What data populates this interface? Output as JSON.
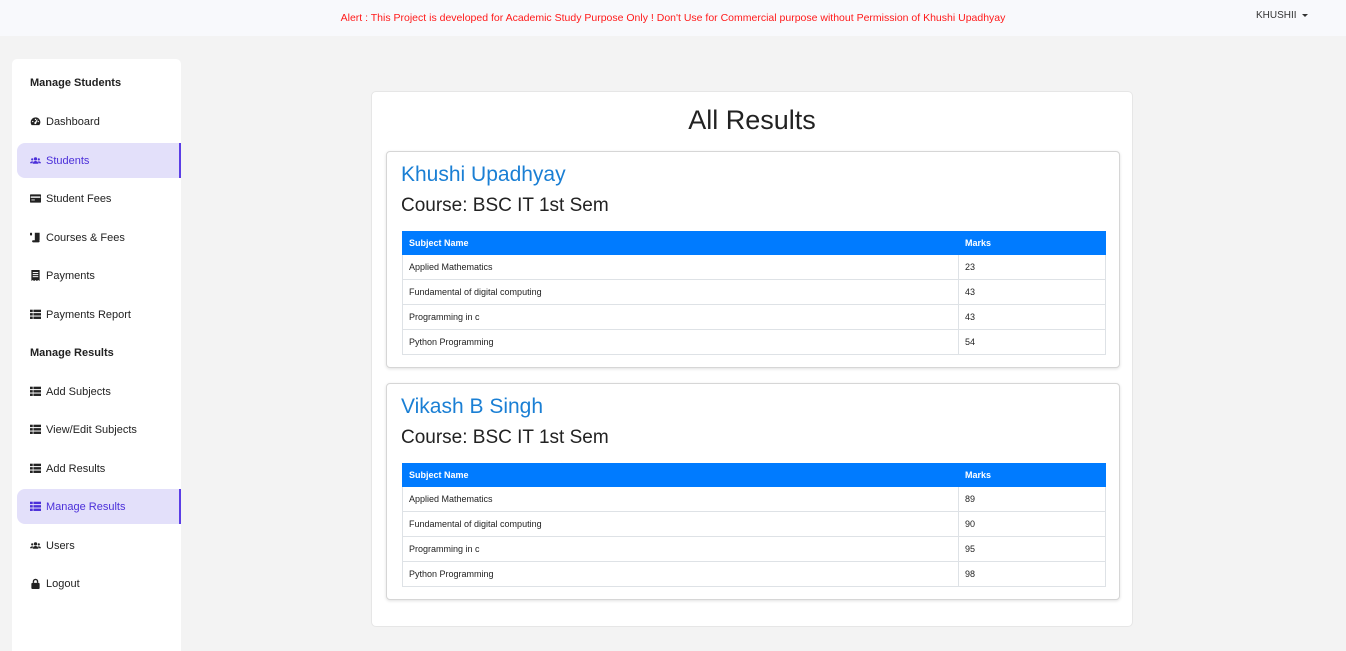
{
  "topbar": {
    "alert": "Alert : This Project is developed for Academic Study Purpose Only ! Don't Use for Commercial purpose without Permission of Khushi Upadhyay",
    "user": "KHUSHII",
    "alert_color": "#ff1a1a"
  },
  "sidebar": {
    "heading_students": "Manage Students",
    "heading_results": "Manage Results",
    "items": [
      {
        "label": "Dashboard",
        "icon": "dashboard-icon"
      },
      {
        "label": "Students",
        "icon": "users-icon",
        "active": true
      },
      {
        "label": "Student Fees",
        "icon": "card-icon"
      },
      {
        "label": "Courses & Fees",
        "icon": "scroll-icon"
      },
      {
        "label": "Payments",
        "icon": "receipt-icon"
      },
      {
        "label": "Payments Report",
        "icon": "list-icon"
      },
      {
        "label": "Add Subjects",
        "icon": "list-icon"
      },
      {
        "label": "View/Edit Subjects",
        "icon": "list-icon"
      },
      {
        "label": "Add Results",
        "icon": "list-icon"
      },
      {
        "label": "Manage Results",
        "icon": "list-icon",
        "active": true
      },
      {
        "label": "Users",
        "icon": "users-icon"
      },
      {
        "label": "Logout",
        "icon": "lock-icon"
      }
    ]
  },
  "main": {
    "title": "All Results",
    "table_headers": {
      "subject": "Subject Name",
      "marks": "Marks"
    },
    "header_color": "#007bff",
    "results": [
      {
        "name": "Khushi Upadhyay",
        "course": "Course: BSC IT 1st Sem",
        "rows": [
          {
            "subject": "Applied Mathematics",
            "marks": "23"
          },
          {
            "subject": "Fundamental of digital computing",
            "marks": "43"
          },
          {
            "subject": "Programming in c",
            "marks": "43"
          },
          {
            "subject": "Python Programming",
            "marks": "54"
          }
        ]
      },
      {
        "name": "Vikash B Singh",
        "course": "Course: BSC IT 1st Sem",
        "rows": [
          {
            "subject": "Applied Mathematics",
            "marks": "89"
          },
          {
            "subject": "Fundamental of digital computing",
            "marks": "90"
          },
          {
            "subject": "Programming in c",
            "marks": "95"
          },
          {
            "subject": "Python Programming",
            "marks": "98"
          }
        ]
      }
    ]
  }
}
